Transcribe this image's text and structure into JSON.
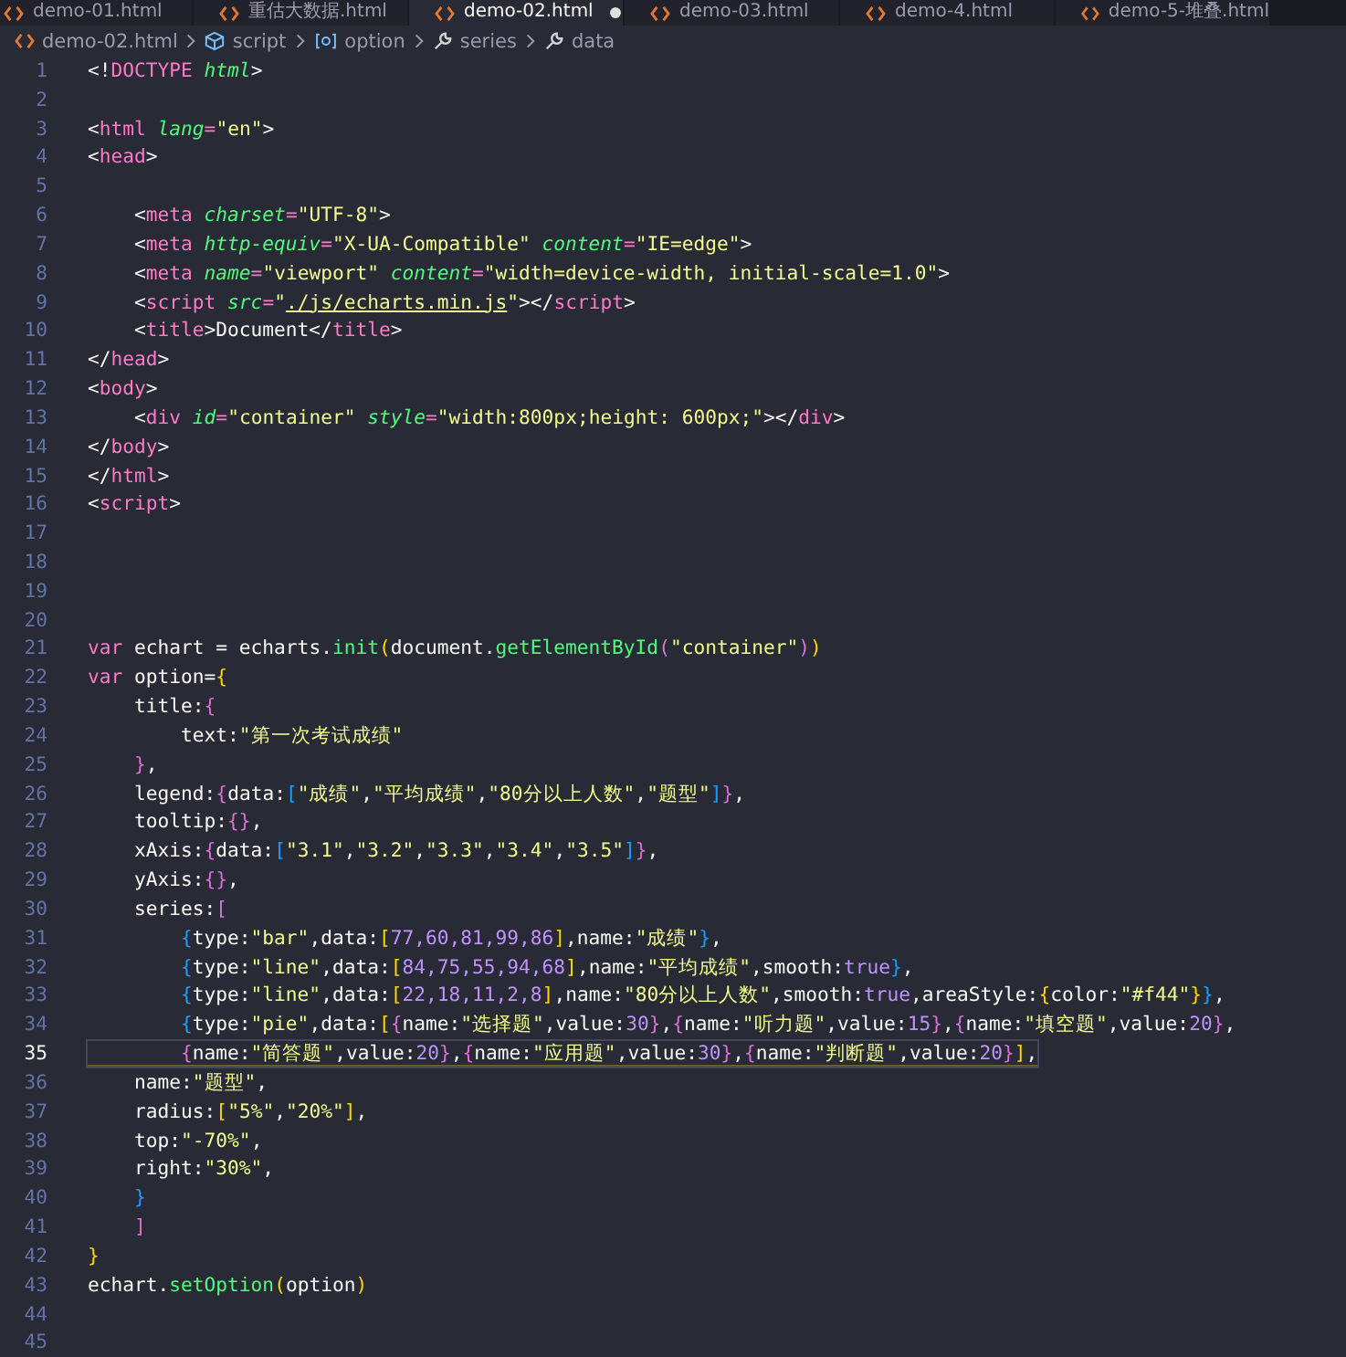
{
  "tabs": [
    {
      "label": "demo-01.html",
      "selected": false,
      "modified": false
    },
    {
      "label": "重估大数据.html",
      "selected": false,
      "modified": false
    },
    {
      "label": "demo-02.html",
      "selected": true,
      "modified": true
    },
    {
      "label": "demo-03.html",
      "selected": false,
      "modified": false
    },
    {
      "label": "demo-4.html",
      "selected": false,
      "modified": false
    },
    {
      "label": "demo-5-堆叠.html",
      "selected": false,
      "modified": false
    }
  ],
  "breadcrumb": [
    {
      "kind": "file",
      "label": "demo-02.html"
    },
    {
      "kind": "module",
      "label": "script"
    },
    {
      "kind": "variable",
      "label": "option"
    },
    {
      "kind": "property",
      "label": "series"
    },
    {
      "kind": "property",
      "label": "data"
    }
  ],
  "lines": [
    {
      "number": "1",
      "current": false,
      "tokens": [
        {
          "kind": "plain",
          "text": "<!"
        },
        {
          "kind": "tag",
          "text": "DOCTYPE"
        },
        {
          "kind": "attr",
          "text": " html"
        },
        {
          "kind": "plain",
          "text": ">"
        }
      ]
    },
    {
      "number": "2",
      "current": false
    },
    {
      "number": "3",
      "current": false,
      "tokens": [
        {
          "kind": "plain",
          "text": "<"
        },
        {
          "kind": "tag",
          "text": "html"
        },
        {
          "kind": "attr",
          "text": " lang"
        },
        {
          "kind": "tag",
          "text": "="
        },
        {
          "kind": "str",
          "text": "\"en\""
        },
        {
          "kind": "plain",
          "text": ">"
        }
      ]
    },
    {
      "number": "4",
      "current": false,
      "tokens": [
        {
          "kind": "plain",
          "text": "<"
        },
        {
          "kind": "tag",
          "text": "head"
        },
        {
          "kind": "plain",
          "text": ">"
        }
      ]
    },
    {
      "number": "5",
      "current": false
    },
    {
      "number": "6",
      "current": false,
      "tokens": [
        {
          "kind": "plain",
          "text": "    <"
        },
        {
          "kind": "tag",
          "text": "meta"
        },
        {
          "kind": "attr",
          "text": " charset"
        },
        {
          "kind": "tag",
          "text": "="
        },
        {
          "kind": "str",
          "text": "\"UTF-8\""
        },
        {
          "kind": "plain",
          "text": ">"
        }
      ]
    },
    {
      "number": "7",
      "current": false,
      "tokens": [
        {
          "kind": "plain",
          "text": "    <"
        },
        {
          "kind": "tag",
          "text": "meta"
        },
        {
          "kind": "attr",
          "text": " http-equiv"
        },
        {
          "kind": "tag",
          "text": "="
        },
        {
          "kind": "str",
          "text": "\"X-UA-Compatible\""
        },
        {
          "kind": "attr",
          "text": " content"
        },
        {
          "kind": "tag",
          "text": "="
        },
        {
          "kind": "str",
          "text": "\"IE=edge\""
        },
        {
          "kind": "plain",
          "text": ">"
        }
      ]
    },
    {
      "number": "8",
      "current": false,
      "tokens": [
        {
          "kind": "plain",
          "text": "    <"
        },
        {
          "kind": "tag",
          "text": "meta"
        },
        {
          "kind": "attr",
          "text": " name"
        },
        {
          "kind": "tag",
          "text": "="
        },
        {
          "kind": "str",
          "text": "\"viewport\""
        },
        {
          "kind": "attr",
          "text": " content"
        },
        {
          "kind": "tag",
          "text": "="
        },
        {
          "kind": "str",
          "text": "\"width=device-width, initial-scale=1.0\""
        },
        {
          "kind": "plain",
          "text": ">"
        }
      ]
    },
    {
      "number": "9",
      "current": false,
      "tokens": [
        {
          "kind": "plain",
          "text": "    <"
        },
        {
          "kind": "tag",
          "text": "script"
        },
        {
          "kind": "attr",
          "text": " src"
        },
        {
          "kind": "tag",
          "text": "="
        },
        {
          "kind": "str",
          "text": "\""
        },
        {
          "kind": "link",
          "text": "./js/echarts.min.js"
        },
        {
          "kind": "str",
          "text": "\""
        },
        {
          "kind": "plain",
          "text": "></"
        },
        {
          "kind": "tag",
          "text": "script"
        },
        {
          "kind": "plain",
          "text": ">"
        }
      ]
    },
    {
      "number": "10",
      "current": false,
      "tokens": [
        {
          "kind": "plain",
          "text": "    <"
        },
        {
          "kind": "tag",
          "text": "title"
        },
        {
          "kind": "plain",
          "text": ">Document</"
        },
        {
          "kind": "tag",
          "text": "title"
        },
        {
          "kind": "plain",
          "text": ">"
        }
      ]
    },
    {
      "number": "11",
      "current": false,
      "tokens": [
        {
          "kind": "plain",
          "text": "</"
        },
        {
          "kind": "tag",
          "text": "head"
        },
        {
          "kind": "plain",
          "text": ">"
        }
      ]
    },
    {
      "number": "12",
      "current": false,
      "tokens": [
        {
          "kind": "plain",
          "text": "<"
        },
        {
          "kind": "tag",
          "text": "body"
        },
        {
          "kind": "plain",
          "text": ">"
        }
      ]
    },
    {
      "number": "13",
      "current": false,
      "tokens": [
        {
          "kind": "plain",
          "text": "    <"
        },
        {
          "kind": "tag",
          "text": "div"
        },
        {
          "kind": "attr",
          "text": " id"
        },
        {
          "kind": "tag",
          "text": "="
        },
        {
          "kind": "str",
          "text": "\"container\""
        },
        {
          "kind": "attr",
          "text": " style"
        },
        {
          "kind": "tag",
          "text": "="
        },
        {
          "kind": "str",
          "text": "\"width:800px;height: 600px;\""
        },
        {
          "kind": "plain",
          "text": "></"
        },
        {
          "kind": "tag",
          "text": "div"
        },
        {
          "kind": "plain",
          "text": ">"
        }
      ]
    },
    {
      "number": "14",
      "current": false,
      "tokens": [
        {
          "kind": "plain",
          "text": "</"
        },
        {
          "kind": "tag",
          "text": "body"
        },
        {
          "kind": "plain",
          "text": ">"
        }
      ]
    },
    {
      "number": "15",
      "current": false,
      "tokens": [
        {
          "kind": "plain",
          "text": "</"
        },
        {
          "kind": "tag",
          "text": "html"
        },
        {
          "kind": "plain",
          "text": ">"
        }
      ]
    },
    {
      "number": "16",
      "current": false,
      "tokens": [
        {
          "kind": "plain",
          "text": "<"
        },
        {
          "kind": "tag",
          "text": "script"
        },
        {
          "kind": "plain",
          "text": ">"
        }
      ]
    },
    {
      "number": "17",
      "current": false
    },
    {
      "number": "18",
      "current": false
    },
    {
      "number": "19",
      "current": false
    },
    {
      "number": "20",
      "current": false
    },
    {
      "number": "21",
      "current": false,
      "tokens": [
        {
          "kind": "kw",
          "text": "var"
        },
        {
          "kind": "plain",
          "text": " echart = echarts."
        },
        {
          "kind": "fn",
          "text": "init"
        },
        {
          "kind": "b1",
          "text": "("
        },
        {
          "kind": "plain",
          "text": "document."
        },
        {
          "kind": "fn",
          "text": "getElementById"
        },
        {
          "kind": "b2",
          "text": "("
        },
        {
          "kind": "str",
          "text": "\"container\""
        },
        {
          "kind": "b2",
          "text": ")"
        },
        {
          "kind": "b1",
          "text": ")"
        }
      ]
    },
    {
      "number": "22",
      "current": false,
      "tokens": [
        {
          "kind": "kw",
          "text": "var"
        },
        {
          "kind": "plain",
          "text": " option="
        },
        {
          "kind": "b1",
          "text": "{"
        }
      ]
    },
    {
      "number": "23",
      "current": false,
      "tokens": [
        {
          "kind": "plain",
          "text": "    title:"
        },
        {
          "kind": "b2",
          "text": "{"
        }
      ]
    },
    {
      "number": "24",
      "current": false,
      "tokens": [
        {
          "kind": "plain",
          "text": "        text:"
        },
        {
          "kind": "str",
          "text": "\"第一次考试成绩\""
        }
      ]
    },
    {
      "number": "25",
      "current": false,
      "tokens": [
        {
          "kind": "b2",
          "text": "    }"
        },
        {
          "kind": "plain",
          "text": ","
        }
      ]
    },
    {
      "number": "26",
      "current": false,
      "tokens": [
        {
          "kind": "plain",
          "text": "    legend:"
        },
        {
          "kind": "b2",
          "text": "{"
        },
        {
          "kind": "plain",
          "text": "data:"
        },
        {
          "kind": "b3",
          "text": "["
        },
        {
          "kind": "str",
          "text": "\"成绩\""
        },
        {
          "kind": "plain",
          "text": ","
        },
        {
          "kind": "str",
          "text": "\"平均成绩\""
        },
        {
          "kind": "plain",
          "text": ","
        },
        {
          "kind": "str",
          "text": "\"80分以上人数\""
        },
        {
          "kind": "plain",
          "text": ","
        },
        {
          "kind": "str",
          "text": "\"题型\""
        },
        {
          "kind": "b3",
          "text": "]"
        },
        {
          "kind": "b2",
          "text": "}"
        },
        {
          "kind": "plain",
          "text": ","
        }
      ]
    },
    {
      "number": "27",
      "current": false,
      "tokens": [
        {
          "kind": "plain",
          "text": "    tooltip:"
        },
        {
          "kind": "b2",
          "text": "{}"
        },
        {
          "kind": "plain",
          "text": ","
        }
      ]
    },
    {
      "number": "28",
      "current": false,
      "tokens": [
        {
          "kind": "plain",
          "text": "    xAxis:"
        },
        {
          "kind": "b2",
          "text": "{"
        },
        {
          "kind": "plain",
          "text": "data:"
        },
        {
          "kind": "b3",
          "text": "["
        },
        {
          "kind": "str",
          "text": "\"3.1\""
        },
        {
          "kind": "plain",
          "text": ","
        },
        {
          "kind": "str",
          "text": "\"3.2\""
        },
        {
          "kind": "plain",
          "text": ","
        },
        {
          "kind": "str",
          "text": "\"3.3\""
        },
        {
          "kind": "plain",
          "text": ","
        },
        {
          "kind": "str",
          "text": "\"3.4\""
        },
        {
          "kind": "plain",
          "text": ","
        },
        {
          "kind": "str",
          "text": "\"3.5\""
        },
        {
          "kind": "b3",
          "text": "]"
        },
        {
          "kind": "b2",
          "text": "}"
        },
        {
          "kind": "plain",
          "text": ","
        }
      ]
    },
    {
      "number": "29",
      "current": false,
      "tokens": [
        {
          "kind": "plain",
          "text": "    yAxis:"
        },
        {
          "kind": "b2",
          "text": "{}"
        },
        {
          "kind": "plain",
          "text": ","
        }
      ]
    },
    {
      "number": "30",
      "current": false,
      "tokens": [
        {
          "kind": "plain",
          "text": "    series:"
        },
        {
          "kind": "b2",
          "text": "["
        }
      ]
    },
    {
      "number": "31",
      "current": false,
      "tokens": [
        {
          "kind": "b3",
          "text": "        {"
        },
        {
          "kind": "plain",
          "text": "type:"
        },
        {
          "kind": "str",
          "text": "\"bar\""
        },
        {
          "kind": "plain",
          "text": ",data:"
        },
        {
          "kind": "b1",
          "text": "["
        },
        {
          "kind": "num",
          "text": "77,60,81,99,86"
        },
        {
          "kind": "b1",
          "text": "]"
        },
        {
          "kind": "plain",
          "text": ",name:"
        },
        {
          "kind": "str",
          "text": "\"成绩\""
        },
        {
          "kind": "b3",
          "text": "}"
        },
        {
          "kind": "plain",
          "text": ","
        }
      ]
    },
    {
      "number": "32",
      "current": false,
      "tokens": [
        {
          "kind": "b3",
          "text": "        {"
        },
        {
          "kind": "plain",
          "text": "type:"
        },
        {
          "kind": "str",
          "text": "\"line\""
        },
        {
          "kind": "plain",
          "text": ",data:"
        },
        {
          "kind": "b1",
          "text": "["
        },
        {
          "kind": "num",
          "text": "84,75,55,94,68"
        },
        {
          "kind": "b1",
          "text": "]"
        },
        {
          "kind": "plain",
          "text": ",name:"
        },
        {
          "kind": "str",
          "text": "\"平均成绩\""
        },
        {
          "kind": "plain",
          "text": ",smooth:"
        },
        {
          "kind": "num",
          "text": "true"
        },
        {
          "kind": "b3",
          "text": "}"
        },
        {
          "kind": "plain",
          "text": ","
        }
      ]
    },
    {
      "number": "33",
      "current": false,
      "tokens": [
        {
          "kind": "b3",
          "text": "        {"
        },
        {
          "kind": "plain",
          "text": "type:"
        },
        {
          "kind": "str",
          "text": "\"line\""
        },
        {
          "kind": "plain",
          "text": ",data:"
        },
        {
          "kind": "b1",
          "text": "["
        },
        {
          "kind": "num",
          "text": "22,18,11,2,8"
        },
        {
          "kind": "b1",
          "text": "]"
        },
        {
          "kind": "plain",
          "text": ",name:"
        },
        {
          "kind": "str",
          "text": "\"80分以上人数\""
        },
        {
          "kind": "plain",
          "text": ",smooth:"
        },
        {
          "kind": "num",
          "text": "true"
        },
        {
          "kind": "plain",
          "text": ",areaStyle:"
        },
        {
          "kind": "b1",
          "text": "{"
        },
        {
          "kind": "plain",
          "text": "color:"
        },
        {
          "kind": "str",
          "text": "\"#f44\""
        },
        {
          "kind": "b1",
          "text": "}"
        },
        {
          "kind": "b3",
          "text": "}"
        },
        {
          "kind": "plain",
          "text": ","
        }
      ]
    },
    {
      "number": "34",
      "current": false,
      "tokens": [
        {
          "kind": "b3",
          "text": "        {"
        },
        {
          "kind": "plain",
          "text": "type:"
        },
        {
          "kind": "str",
          "text": "\"pie\""
        },
        {
          "kind": "plain",
          "text": ",data:"
        },
        {
          "kind": "b1",
          "text": "["
        },
        {
          "kind": "b2",
          "text": "{"
        },
        {
          "kind": "plain",
          "text": "name:"
        },
        {
          "kind": "str",
          "text": "\"选择题\""
        },
        {
          "kind": "plain",
          "text": ",value:"
        },
        {
          "kind": "num",
          "text": "30"
        },
        {
          "kind": "b2",
          "text": "}"
        },
        {
          "kind": "plain",
          "text": ","
        },
        {
          "kind": "b2",
          "text": "{"
        },
        {
          "kind": "plain",
          "text": "name:"
        },
        {
          "kind": "str",
          "text": "\"听力题\""
        },
        {
          "kind": "plain",
          "text": ",value:"
        },
        {
          "kind": "num",
          "text": "15"
        },
        {
          "kind": "b2",
          "text": "}"
        },
        {
          "kind": "plain",
          "text": ","
        },
        {
          "kind": "b2",
          "text": "{"
        },
        {
          "kind": "plain",
          "text": "name:"
        },
        {
          "kind": "str",
          "text": "\"填空题\""
        },
        {
          "kind": "plain",
          "text": ",value:"
        },
        {
          "kind": "num",
          "text": "20"
        },
        {
          "kind": "b2",
          "text": "}"
        },
        {
          "kind": "plain",
          "text": ","
        }
      ]
    },
    {
      "number": "35",
      "current": true,
      "tokens": [
        {
          "kind": "b2",
          "text": "        {"
        },
        {
          "kind": "plain",
          "text": "name:"
        },
        {
          "kind": "str",
          "text": "\"简答题\""
        },
        {
          "kind": "plain",
          "text": ",value:"
        },
        {
          "kind": "num",
          "text": "20"
        },
        {
          "kind": "b2",
          "text": "}"
        },
        {
          "kind": "plain",
          "text": ","
        },
        {
          "kind": "b2",
          "text": "{"
        },
        {
          "kind": "plain",
          "text": "name:"
        },
        {
          "kind": "str",
          "text": "\"应用题\""
        },
        {
          "kind": "plain",
          "text": ",value:"
        },
        {
          "kind": "num",
          "text": "30"
        },
        {
          "kind": "b2",
          "text": "}"
        },
        {
          "kind": "plain",
          "text": ","
        },
        {
          "kind": "b2",
          "text": "{"
        },
        {
          "kind": "plain",
          "text": "name:"
        },
        {
          "kind": "str",
          "text": "\"判断题\""
        },
        {
          "kind": "plain",
          "text": ",value:"
        },
        {
          "kind": "num",
          "text": "20"
        },
        {
          "kind": "b2",
          "text": "}"
        },
        {
          "kind": "b1",
          "text": "]"
        },
        {
          "kind": "plain",
          "text": ","
        }
      ]
    },
    {
      "number": "36",
      "current": false,
      "tokens": [
        {
          "kind": "plain",
          "text": "    name:"
        },
        {
          "kind": "str",
          "text": "\"题型\""
        },
        {
          "kind": "plain",
          "text": ","
        }
      ]
    },
    {
      "number": "37",
      "current": false,
      "tokens": [
        {
          "kind": "plain",
          "text": "    radius:"
        },
        {
          "kind": "b1",
          "text": "["
        },
        {
          "kind": "str",
          "text": "\"5%\""
        },
        {
          "kind": "plain",
          "text": ","
        },
        {
          "kind": "str",
          "text": "\"20%\""
        },
        {
          "kind": "b1",
          "text": "]"
        },
        {
          "kind": "plain",
          "text": ","
        }
      ]
    },
    {
      "number": "38",
      "current": false,
      "tokens": [
        {
          "kind": "plain",
          "text": "    top:"
        },
        {
          "kind": "str",
          "text": "\"-70%\""
        },
        {
          "kind": "plain",
          "text": ","
        }
      ]
    },
    {
      "number": "39",
      "current": false,
      "tokens": [
        {
          "kind": "plain",
          "text": "    right:"
        },
        {
          "kind": "str",
          "text": "\"30%\""
        },
        {
          "kind": "plain",
          "text": ","
        }
      ]
    },
    {
      "number": "40",
      "current": false,
      "tokens": [
        {
          "kind": "b3",
          "text": "    }"
        }
      ]
    },
    {
      "number": "41",
      "current": false,
      "tokens": [
        {
          "kind": "b2",
          "text": "    ]"
        }
      ]
    },
    {
      "number": "42",
      "current": false,
      "tokens": [
        {
          "kind": "b1",
          "text": "}"
        }
      ]
    },
    {
      "number": "43",
      "current": false,
      "tokens": [
        {
          "kind": "plain",
          "text": "echart."
        },
        {
          "kind": "fn",
          "text": "setOption"
        },
        {
          "kind": "b1",
          "text": "("
        },
        {
          "kind": "plain",
          "text": "option"
        },
        {
          "kind": "b1",
          "text": ")"
        }
      ]
    },
    {
      "number": "44",
      "current": false
    },
    {
      "number": "45",
      "current": false
    }
  ]
}
